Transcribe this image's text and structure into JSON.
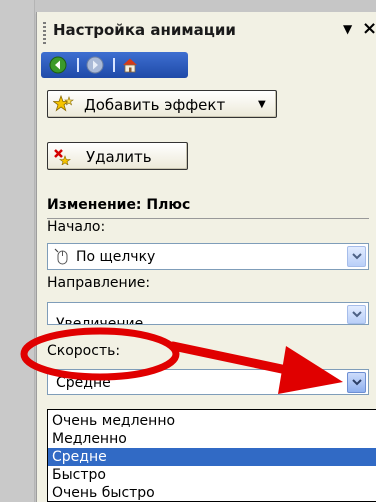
{
  "title": "Настройка анимации",
  "toolbar": {
    "add_effect": "Добавить эффект",
    "delete": "Удалить"
  },
  "effect_heading": "Изменение: Плюс",
  "start": {
    "label": "Начало:",
    "value": "По щелчку"
  },
  "direction": {
    "label": "Направление:",
    "value": "Увеличение"
  },
  "speed": {
    "label": "Скорость:",
    "value": "Средне",
    "options": [
      "Очень медленно",
      "Медленно",
      "Средне",
      "Быстро",
      "Очень быстро"
    ],
    "selected_index": 2
  },
  "colors": {
    "annotation_red": "#e00000",
    "selection_blue": "#316ac5",
    "pane_bg": "#f2f1e4"
  },
  "icons": [
    "back-icon",
    "forward-icon",
    "home-icon",
    "add-effect-star-icon",
    "delete-effect-icon",
    "mouse-click-icon",
    "chevron-down-icon"
  ]
}
